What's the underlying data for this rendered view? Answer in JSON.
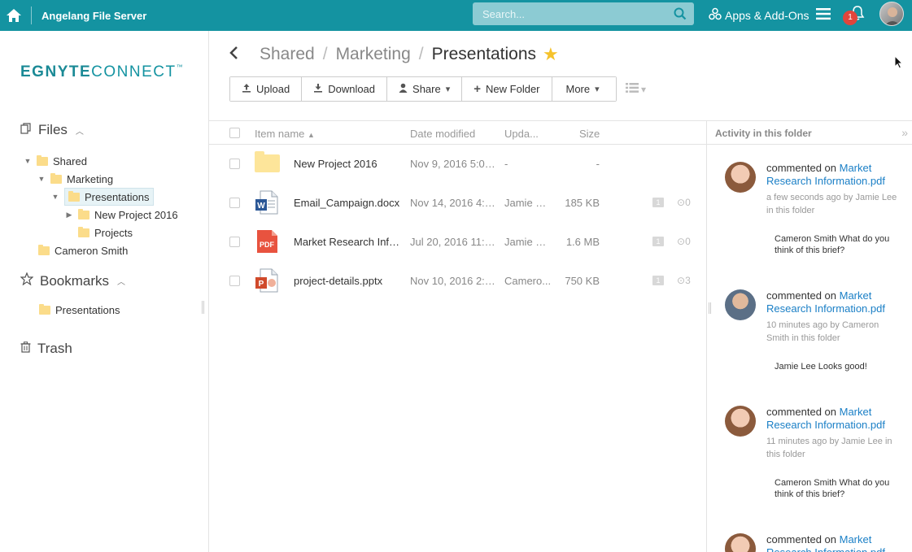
{
  "topbar": {
    "app_title": "Angelang File Server",
    "search_placeholder": "Search...",
    "apps_label": "Apps & Add-Ons",
    "notification_count": "1"
  },
  "sidebar": {
    "logo": {
      "left": "EGN",
      "mid": "Y",
      "right": "TE",
      "connect": "CONNECT",
      "tm": "™"
    },
    "files_label": "Files",
    "tree": [
      {
        "label": "Shared"
      },
      {
        "label": "Marketing"
      },
      {
        "label": "Presentations"
      },
      {
        "label": "New Project 2016"
      },
      {
        "label": "Projects"
      },
      {
        "label": "Cameron Smith"
      }
    ],
    "bookmarks_label": "Bookmarks",
    "bookmarks": [
      {
        "label": "Presentations"
      }
    ],
    "trash_label": "Trash"
  },
  "breadcrumb": {
    "items": [
      "Shared",
      "Marketing"
    ],
    "current": "Presentations",
    "separator": "/"
  },
  "toolbar": {
    "upload": "Upload",
    "download": "Download",
    "share": "Share",
    "new_folder": "New Folder",
    "more": "More"
  },
  "table": {
    "headers": {
      "name": "Item name",
      "date": "Date modified",
      "updated": "Upda...",
      "size": "Size"
    },
    "rows": [
      {
        "name": "New Project 2016",
        "date": "Nov 9, 2016 5:03...",
        "updated_by": "-",
        "size": "-",
        "type": "folder",
        "comments": "",
        "versions": ""
      },
      {
        "name": "Email_Campaign.docx",
        "date": "Nov 14, 2016 4:0...",
        "updated_by": "Jamie Lee",
        "size": "185 KB",
        "type": "docx",
        "comments": "1",
        "versions": "0"
      },
      {
        "name": "Market Research Infor...",
        "date": "Jul 20, 2016 11:58...",
        "updated_by": "Jamie Lee",
        "size": "1.6 MB",
        "type": "pdf",
        "comments": "1",
        "versions": "0"
      },
      {
        "name": "project-details.pptx",
        "date": "Nov 10, 2016 2:0...",
        "updated_by": "Camero...",
        "size": "750 KB",
        "type": "pptx",
        "comments": "1",
        "versions": "3"
      }
    ],
    "pdf_icon_label": "PDF"
  },
  "activity": {
    "title": "Activity in this folder",
    "items": [
      {
        "action": "commented on",
        "link": "Market Research Information.pdf",
        "meta": "a few seconds ago by Jamie Lee in this folder",
        "comment": "Cameron Smith What do you think of this brief?",
        "avatar": "f"
      },
      {
        "action": "commented on",
        "link": "Market Research Information.pdf",
        "meta": "10 minutes ago by Cameron Smith in this folder",
        "comment": "Jamie Lee Looks good!",
        "avatar": "m"
      },
      {
        "action": "commented on",
        "link": "Market Research Information.pdf",
        "meta": "11 minutes ago by Jamie Lee in this folder",
        "comment": "Cameron Smith What do you think of this brief?",
        "avatar": "f"
      },
      {
        "action": "commented on",
        "link": "Market Research Information.pdf",
        "meta": "",
        "comment": "",
        "avatar": "f"
      }
    ]
  },
  "colors": {
    "brand": "#1493a1",
    "link": "#1a7fc6",
    "star": "#f5c22b",
    "badge": "#e0453c"
  }
}
